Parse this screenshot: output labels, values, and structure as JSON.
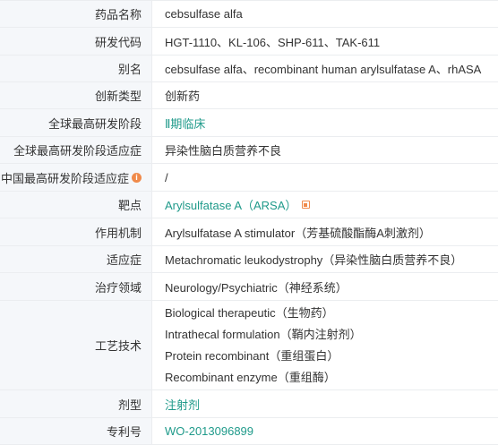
{
  "rows": [
    {
      "label": "药品名称",
      "value": "cebsulfase alfa"
    },
    {
      "label": "研发代码",
      "value": "HGT-1110、KL-106、SHP-611、TAK-611"
    },
    {
      "label": "别名",
      "value": "cebsulfase alfa、recombinant human arylsulfatase A、rhASA"
    },
    {
      "label": "创新类型",
      "value": "创新药"
    },
    {
      "label": "全球最高研发阶段",
      "value": "Ⅱ期临床"
    },
    {
      "label": "全球最高研发阶段适应症",
      "value": "异染性脑白质营养不良"
    },
    {
      "label": "中国最高研发阶段适应症",
      "value": "/",
      "info_icon": "i"
    },
    {
      "label": "靶点",
      "value": "Arylsulfatase A（ARSA）"
    },
    {
      "label": "作用机制",
      "value": "Arylsulfatase A stimulator（芳基硫酸酯酶A刺激剂）"
    },
    {
      "label": "适应症",
      "value": "Metachromatic leukodystrophy（异染性脑白质营养不良）"
    },
    {
      "label": "治疗领域",
      "value": "Neurology/Psychiatric（神经系统）"
    },
    {
      "label": "工艺技术",
      "values": [
        "Biological therapeutic（生物药）",
        "Intrathecal formulation（鞘内注射剂）",
        "Protein recombinant（重组蛋白）",
        "Recombinant enzyme（重组酶）"
      ]
    },
    {
      "label": "剂型",
      "value": "注射剂"
    },
    {
      "label": "专利号",
      "value": "WO-2013096899"
    }
  ],
  "colors": {
    "label_bg": "#f5f7fa",
    "border": "#ebedf0",
    "link": "#1f9a8a",
    "accent_icon": "#f08a4b"
  },
  "icons": {
    "info": "info-circle-icon",
    "external": "external-link-icon"
  }
}
